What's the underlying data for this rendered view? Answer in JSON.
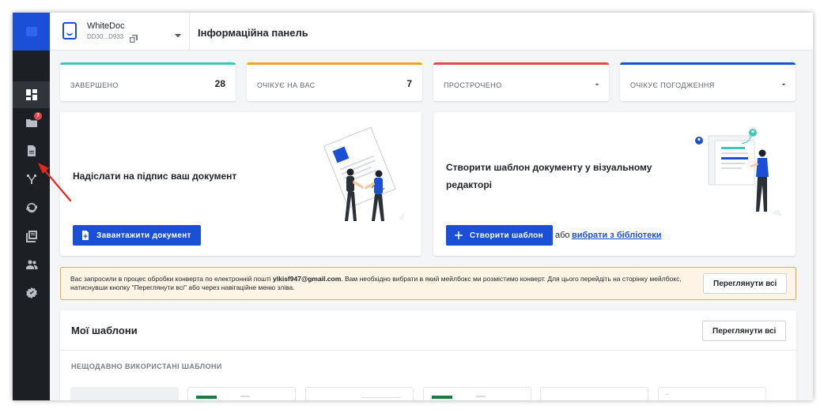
{
  "app": {
    "workspace_name": "WhiteDoc",
    "workspace_id": "DD30...D933",
    "page_title": "Інформаційна панель",
    "accent": "#1b4fd6"
  },
  "sidebar": {
    "items": [
      {
        "icon": "dashboard-icon",
        "active": true
      },
      {
        "icon": "folder-icon",
        "badge": "7"
      },
      {
        "icon": "document-icon"
      },
      {
        "icon": "workflow-fork-icon"
      },
      {
        "icon": "sync-icon"
      },
      {
        "icon": "library-icon"
      },
      {
        "icon": "users-icon"
      },
      {
        "icon": "settings-icon"
      }
    ]
  },
  "stats": [
    {
      "label": "ЗАВЕРШЕНО",
      "value": "28",
      "color": "#3cc7b9"
    },
    {
      "label": "ОЧІКУЄ НА ВАС",
      "value": "7",
      "color": "#f0a42a"
    },
    {
      "label": "ПРОСТРОЧЕНО",
      "value": "-",
      "color": "#e5484d"
    },
    {
      "label": "ОЧІКУЄ ПОГОДЖЕННЯ",
      "value": "-",
      "color": "#1b4fd6"
    }
  ],
  "cards": {
    "upload": {
      "title": "Надіслати на підпис ваш документ",
      "button": "Завантажити документ"
    },
    "template": {
      "title_line1": "Створити шаблон документу у візуальному",
      "title_line2": "редакторі",
      "button": "Створити шаблон",
      "or_text": "або",
      "link": "вибрати з бібліотеки"
    }
  },
  "notice": {
    "text_before": "Вас запросили в процес обробки конверта по електронній пошті ",
    "email": "ylkisf947@gmail.com",
    "text_after": ". Вам необхідно вибрати в який мейлбокс ми розмістимо конверт. Для цього перейдіть на сторінку мейлбокс, натиснувши кнопку \"Переглянути всі\" або через навігаційне меню зліва.",
    "button": "Переглянути всі"
  },
  "templates": {
    "title": "Мої шаблони",
    "view_all": "Переглянути всі",
    "recent_label": "НЕЩОДАВНО ВИКОРИСТАНІ ШАБЛОНИ"
  }
}
